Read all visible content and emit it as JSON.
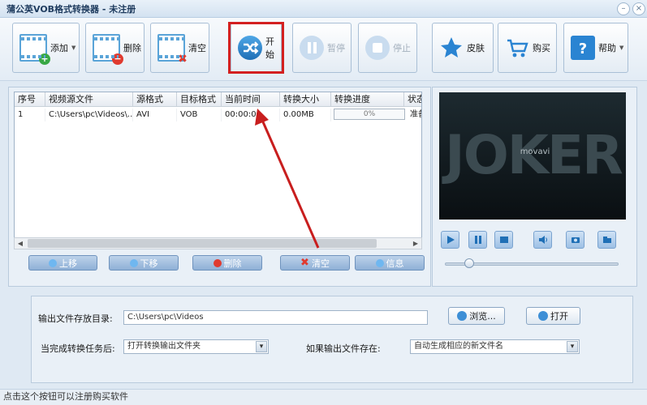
{
  "window": {
    "title": "蒲公英VOB格式转换器 - 未注册",
    "minimize_glyph": "–",
    "close_glyph": "×"
  },
  "toolbar": {
    "add": {
      "label": "添加",
      "icon": "film-add-icon"
    },
    "delete": {
      "label": "删除",
      "icon": "film-delete-icon"
    },
    "clear": {
      "label": "清空",
      "icon": "film-clear-icon"
    },
    "start": {
      "label": "开始",
      "icon": "shuffle-icon"
    },
    "pause": {
      "label": "暂停",
      "icon": "pause-icon"
    },
    "stop": {
      "label": "停止",
      "icon": "stop-icon"
    },
    "skin": {
      "label": "皮肤",
      "icon": "star-icon"
    },
    "buy": {
      "label": "购买",
      "icon": "cart-icon"
    },
    "help": {
      "label": "帮助",
      "icon": "help-icon"
    }
  },
  "table": {
    "columns": [
      "序号",
      "视频源文件",
      "源格式",
      "目标格式",
      "当前时间",
      "转换大小",
      "转换进度",
      "状态"
    ],
    "rows": [
      {
        "index": "1",
        "source": "C:\\Users\\pc\\Videos\\...",
        "src_format": "AVI",
        "target_format": "VOB",
        "current_time": "00:00:00",
        "size": "0.00MB",
        "progress": "0%",
        "progress_value": 0,
        "status": "准备"
      }
    ]
  },
  "list_buttons": {
    "up": "上移",
    "down": "下移",
    "delete": "删除",
    "clear": "清空",
    "info": "信息"
  },
  "preview": {
    "video_text": "JOKER",
    "watermark_text": "movavi",
    "slider_value": 0.14,
    "controls": [
      "play-icon",
      "pause-icon",
      "stop-icon",
      "volume-icon",
      "snapshot-icon",
      "folder-icon"
    ]
  },
  "output": {
    "dir_label": "输出文件存放目录:",
    "dir_value": "C:\\Users\\pc\\Videos",
    "browse_label": "浏览...",
    "open_label": "打开",
    "after_label": "当完成转换任务后:",
    "after_value": "打开转换输出文件夹",
    "exists_label": "如果输出文件存在:",
    "exists_value": "自动生成相应的新文件名"
  },
  "status_text": "点击这个按钮可以注册购买软件",
  "colors": {
    "accent": "#4a90d0",
    "highlight": "#d32020",
    "delete_red": "#e03a2f",
    "add_green": "#39a845"
  }
}
